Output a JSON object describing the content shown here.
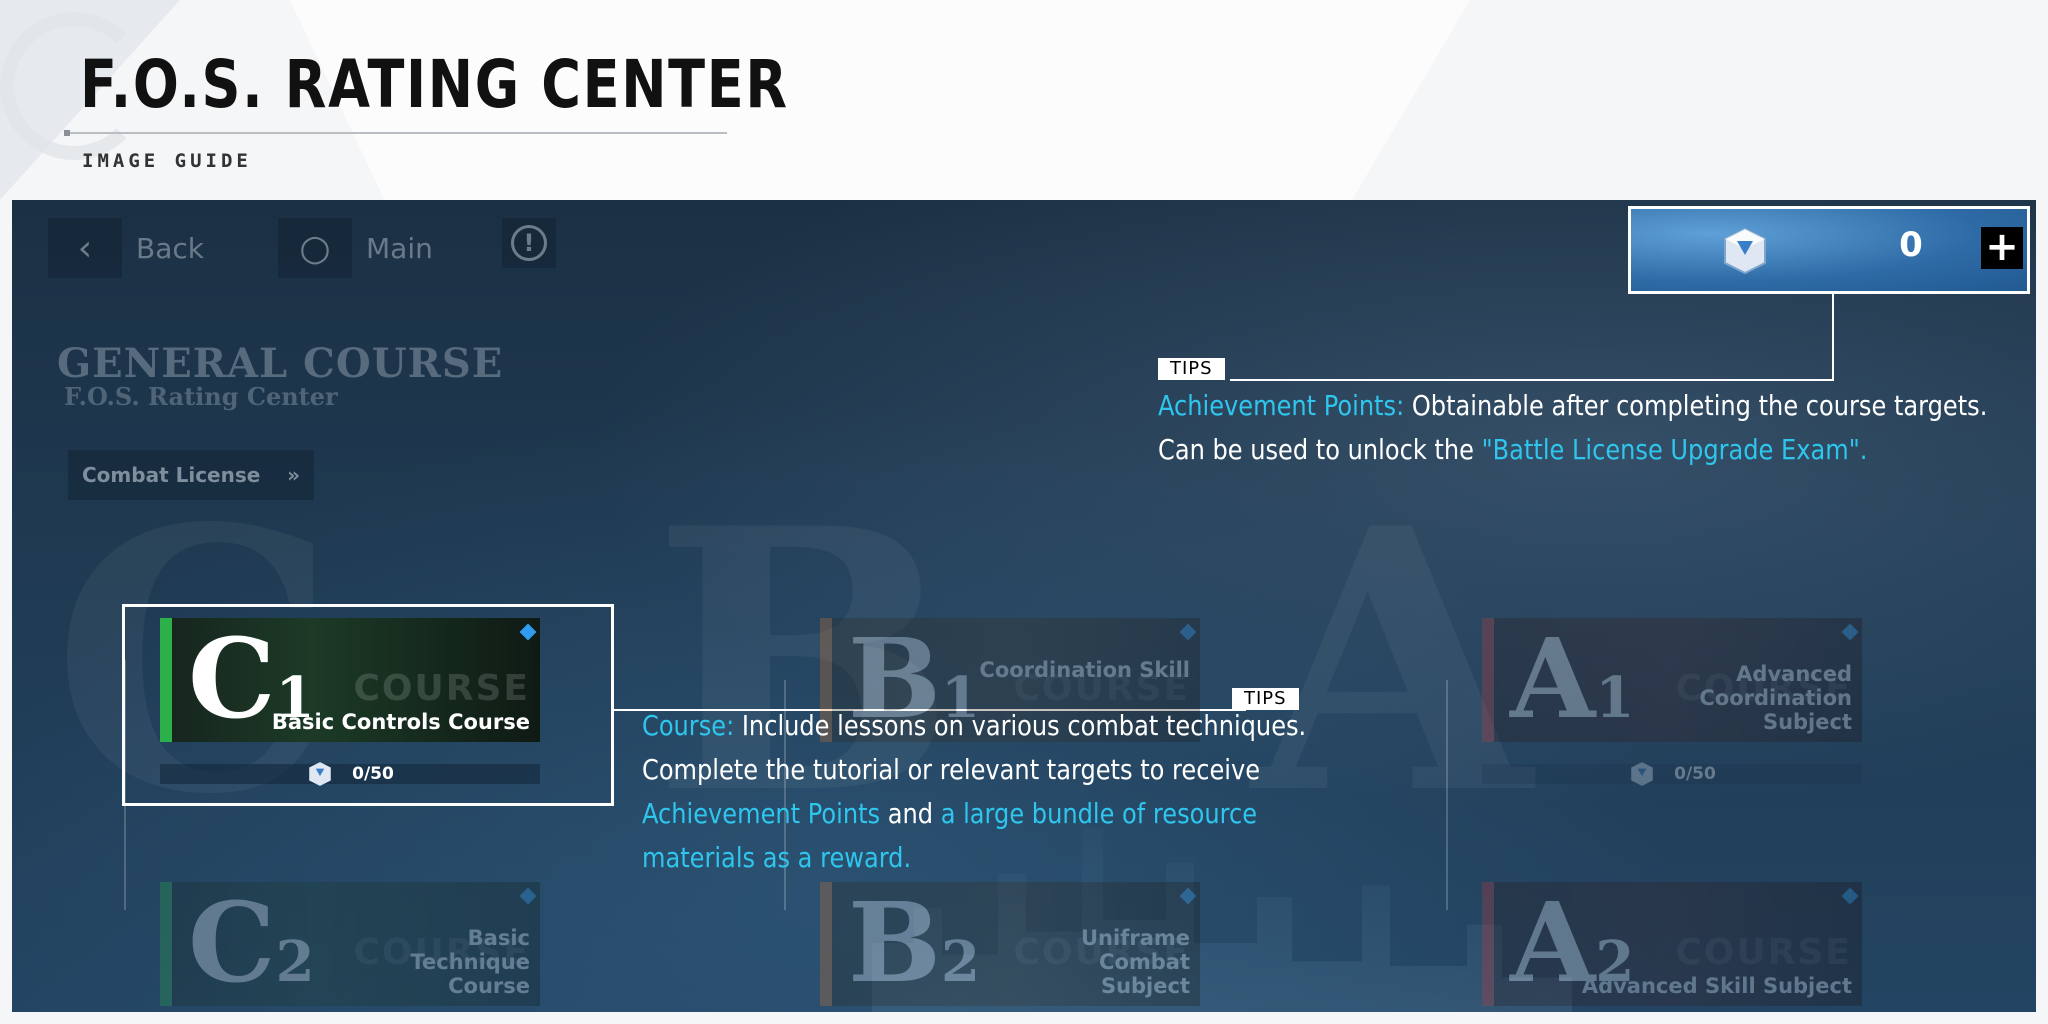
{
  "header": {
    "title": "F.O.S. RATING CENTER",
    "subtitle": "IMAGE GUIDE"
  },
  "nav": {
    "back_label": "Back",
    "main_label": "Main",
    "info_symbol": "!"
  },
  "section": {
    "title": "GENERAL COURSE",
    "subtitle": "F.O.S. Rating Center",
    "license_button": "Combat License",
    "license_chevron": "»"
  },
  "points": {
    "value": "0",
    "plus_symbol": "+"
  },
  "tips_top": {
    "badge": "TIPS",
    "line1_highlight": "Achievement Points:",
    "line1_rest": " Obtainable after completing the course targets.",
    "line2_start": "Can be used to unlock the ",
    "line2_highlight": "\"Battle License Upgrade Exam\"."
  },
  "tips_course": {
    "badge": "TIPS",
    "line1_highlight": "Course:",
    "line1_rest": " Include lessons on various combat techniques.",
    "line2": "Complete the tutorial or relevant targets to receive",
    "line3_highlight1": "Achievement Points",
    "line3_mid": " and ",
    "line3_highlight2": "a large bundle of resource",
    "line4_highlight": "materials as a reward."
  },
  "courses": [
    {
      "grade": "C",
      "level": "1",
      "name": "Basic Controls Course",
      "ghost": "COURSE",
      "progress": "0/50",
      "color": "#2bb04a"
    },
    {
      "grade": "B",
      "level": "1",
      "name": "Coordination Skill",
      "ghost": "COURSE",
      "color": "#d9782a"
    },
    {
      "grade": "A",
      "level": "1",
      "name": "Advanced Coordination Subject",
      "ghost": "COURSE",
      "progress": "0/50",
      "color": "#c83a3a"
    },
    {
      "grade": "C",
      "level": "2",
      "name": "Basic Technique Course",
      "ghost": "COURSE",
      "color": "#2bb04a"
    },
    {
      "grade": "B",
      "level": "2",
      "name": "Uniframe Combat Subject",
      "ghost": "COURSE",
      "color": "#d9782a"
    },
    {
      "grade": "A",
      "level": "2",
      "name": "Advanced Skill Subject",
      "ghost": "COURSE",
      "color": "#c83a3a"
    }
  ],
  "icons": [
    "back-chevron-icon",
    "main-circle-icon",
    "info-icon",
    "achievement-cube-icon",
    "plus-icon"
  ]
}
